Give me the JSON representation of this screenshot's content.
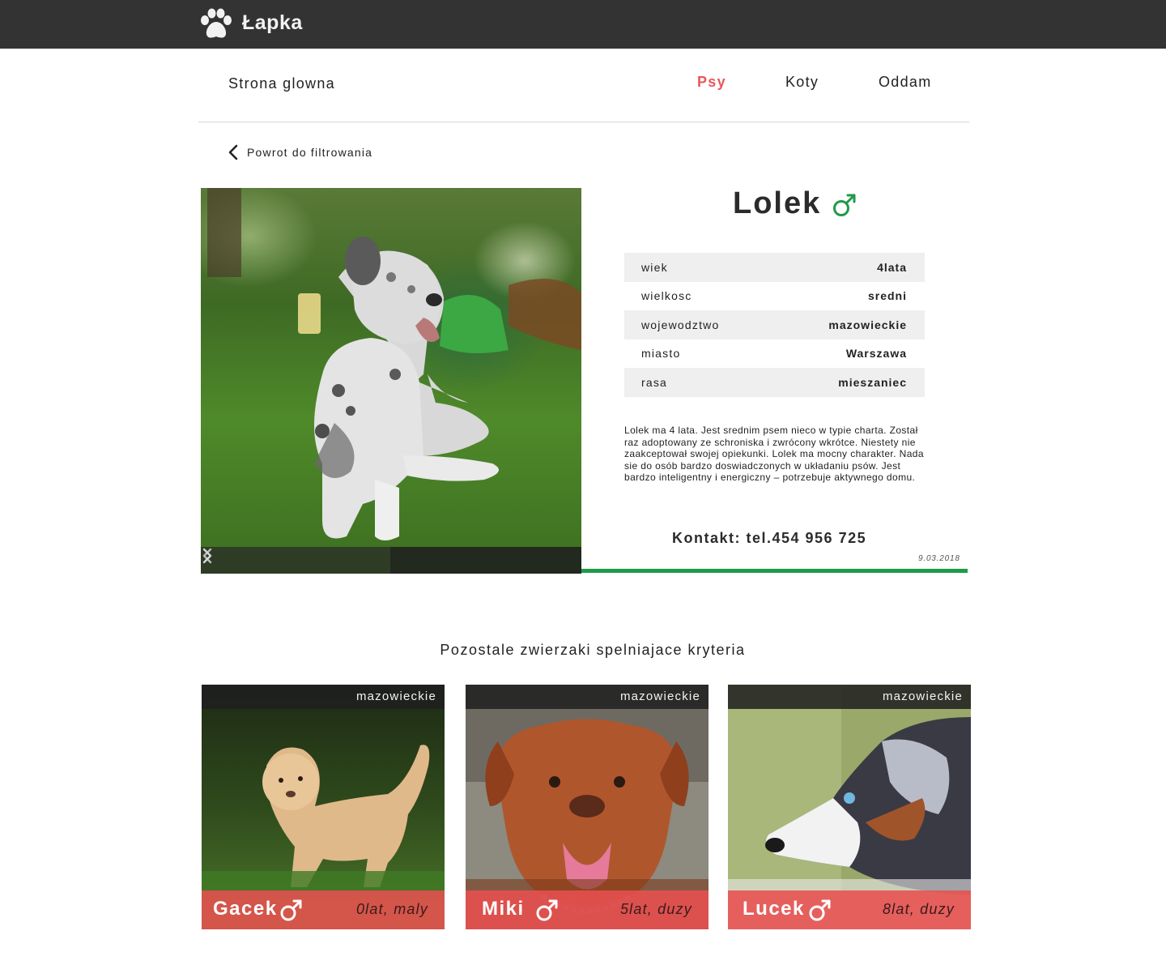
{
  "brand": {
    "name": "Łapka",
    "icon": "paw-icon"
  },
  "nav": {
    "home": "Strona glowna",
    "items": [
      {
        "label": "Psy",
        "active": true
      },
      {
        "label": "Koty",
        "active": false
      },
      {
        "label": "Oddam",
        "active": false
      }
    ]
  },
  "back": {
    "label": "Powrot do filtrowania",
    "icon": "chevron-left-icon"
  },
  "pet": {
    "name": "Lolek",
    "gender_icon": "male-icon",
    "attributes": [
      {
        "key": "wiek",
        "value": "4lata"
      },
      {
        "key": "wielkosc",
        "value": "sredni"
      },
      {
        "key": "wojewodztwo",
        "value": "mazowieckie"
      },
      {
        "key": "miasto",
        "value": "Warszawa"
      },
      {
        "key": "rasa",
        "value": "mieszaniec"
      }
    ],
    "description": "Lolek ma 4 lata. Jest srednim psem nieco w typie charta. Został raz adoptowany ze schroniska i zwrócony wkrótce. Niestety nie zaakceptował swojej opiekunki. Lolek ma mocny charakter. Nada  sie do osób bardzo doswiadczonych w układaniu psów. Jest bardzo inteligentny i energiczny – potrzebuje aktywnego domu.",
    "contact": "Kontakt: tel.454 956 725",
    "date": "9.03.2018"
  },
  "others": {
    "title": "Pozostale zwierzaki spelniajace kryteria",
    "cards": [
      {
        "region": "mazowieckie",
        "name": "Gacek",
        "info": "0lat, maly"
      },
      {
        "region": "mazowieckie",
        "name": "Miki",
        "info": "5lat, duzy"
      },
      {
        "region": "mazowieckie",
        "name": "Lucek",
        "info": "8lat, duzy"
      }
    ]
  },
  "colors": {
    "topbar": "#333333",
    "accent": "#e8575a",
    "green": "#1f9a4a",
    "card_label": "#e85050"
  }
}
